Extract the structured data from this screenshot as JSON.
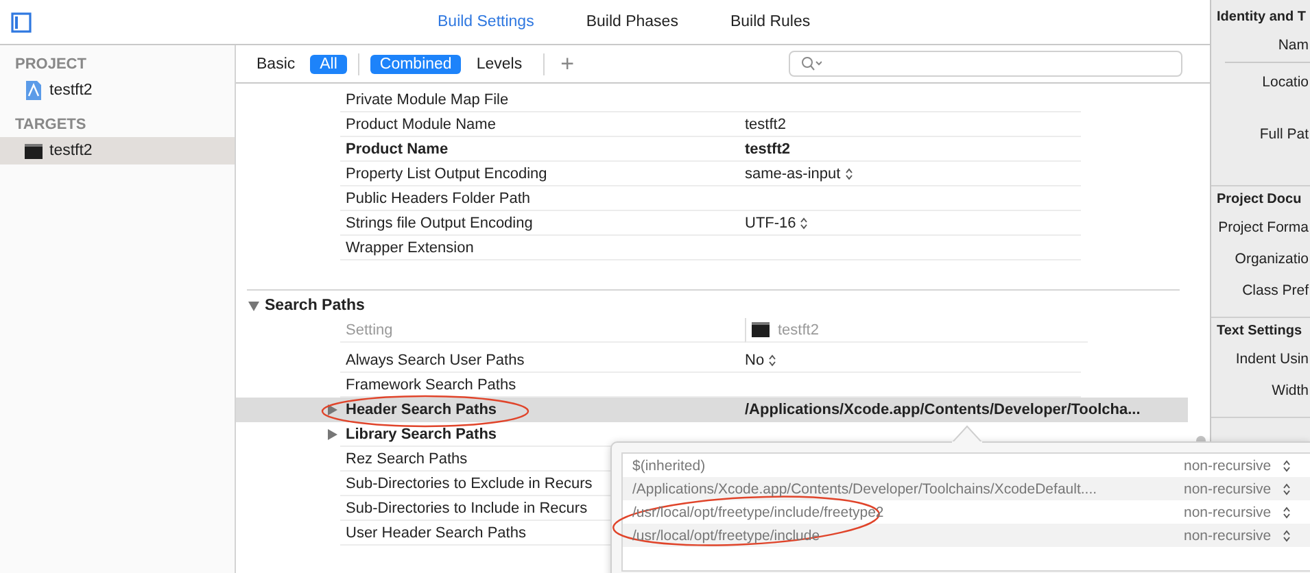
{
  "toolbar": {
    "tabs": [
      {
        "label": "Build Settings",
        "selected": true
      },
      {
        "label": "Build Phases",
        "selected": false
      },
      {
        "label": "Build Rules",
        "selected": false
      }
    ]
  },
  "sidebar": {
    "sections": [
      {
        "title": "PROJECT",
        "items": [
          {
            "label": "testft2",
            "kind": "project",
            "selected": false
          }
        ]
      },
      {
        "title": "TARGETS",
        "items": [
          {
            "label": "testft2",
            "kind": "target",
            "selected": true
          }
        ]
      }
    ]
  },
  "filter_bar": {
    "scope": [
      {
        "label": "Basic",
        "selected": false
      },
      {
        "label": "All",
        "selected": true
      }
    ],
    "view": [
      {
        "label": "Combined",
        "selected": true
      },
      {
        "label": "Levels",
        "selected": false
      }
    ],
    "add": "+"
  },
  "settings": {
    "rows": [
      {
        "name": "Private Module Map File",
        "kind": "text",
        "modified": false
      },
      {
        "name": "Product Module Name",
        "value": "testft2",
        "kind": "text",
        "modified": false
      },
      {
        "name": "Product Name",
        "value": "testft2",
        "kind": "text",
        "modified": true
      },
      {
        "name": "Property List Output Encoding",
        "value": "same-as-input",
        "kind": "popup",
        "modified": false
      },
      {
        "name": "Public Headers Folder Path",
        "kind": "text",
        "modified": false
      },
      {
        "name": "Strings file Output Encoding",
        "value": "UTF-16",
        "kind": "popup",
        "modified": false
      },
      {
        "name": "Wrapper Extension",
        "kind": "text",
        "modified": false
      }
    ]
  },
  "search_paths": {
    "title": "Search Paths",
    "expanded": true,
    "header": {
      "setting": "Setting",
      "target": "testft2"
    },
    "rows": [
      {
        "name": "Always Search User Paths",
        "value": "No",
        "kind": "popup",
        "modified": false,
        "expandable": false,
        "selected": false
      },
      {
        "name": "Framework Search Paths",
        "kind": "text",
        "modified": false,
        "expandable": false,
        "selected": false
      },
      {
        "name": "Header Search Paths",
        "value": "/Applications/Xcode.app/Contents/Developer/Toolcha...",
        "kind": "text",
        "modified": true,
        "expandable": true,
        "selected": true
      },
      {
        "name": "Library Search Paths",
        "kind": "text",
        "modified": true,
        "expandable": true,
        "selected": false
      },
      {
        "name": "Rez Search Paths",
        "kind": "text",
        "modified": false,
        "expandable": false,
        "selected": false
      },
      {
        "name": "Sub-Directories to Exclude in Recurs",
        "kind": "text",
        "modified": false,
        "expandable": false,
        "selected": false
      },
      {
        "name": "Sub-Directories to Include in Recurs",
        "kind": "text",
        "modified": false,
        "expandable": false,
        "selected": false
      },
      {
        "name": "User Header Search Paths",
        "kind": "text",
        "modified": false,
        "expandable": false,
        "selected": false
      }
    ]
  },
  "popover": {
    "rows": [
      {
        "path": "$(inherited)",
        "mode": "non-recursive"
      },
      {
        "path": "/Applications/Xcode.app/Contents/Developer/Toolchains/XcodeDefault....",
        "mode": "non-recursive"
      },
      {
        "path": "/usr/local/opt/freetype/include/freetype2",
        "mode": "non-recursive"
      },
      {
        "path": "/usr/local/opt/freetype/include",
        "mode": "non-recursive"
      }
    ]
  },
  "inspector": {
    "sections": [
      {
        "title": "Identity and T",
        "rows": [
          {
            "label": "Nam",
            "kind": "field"
          },
          {
            "label": "Locatio",
            "kind": "path"
          },
          {
            "label": "Full Pat",
            "kind": "path"
          }
        ]
      },
      {
        "title": "Project Docu",
        "rows": [
          {
            "label": "Project Forma",
            "kind": "field"
          },
          {
            "label": "Organizatio",
            "kind": "field"
          },
          {
            "label": "Class Pref",
            "kind": "field"
          }
        ]
      },
      {
        "title": "Text Settings",
        "rows": [
          {
            "label": "Indent Usin",
            "kind": "field"
          },
          {
            "label": "Width",
            "kind": "field"
          }
        ]
      }
    ]
  }
}
